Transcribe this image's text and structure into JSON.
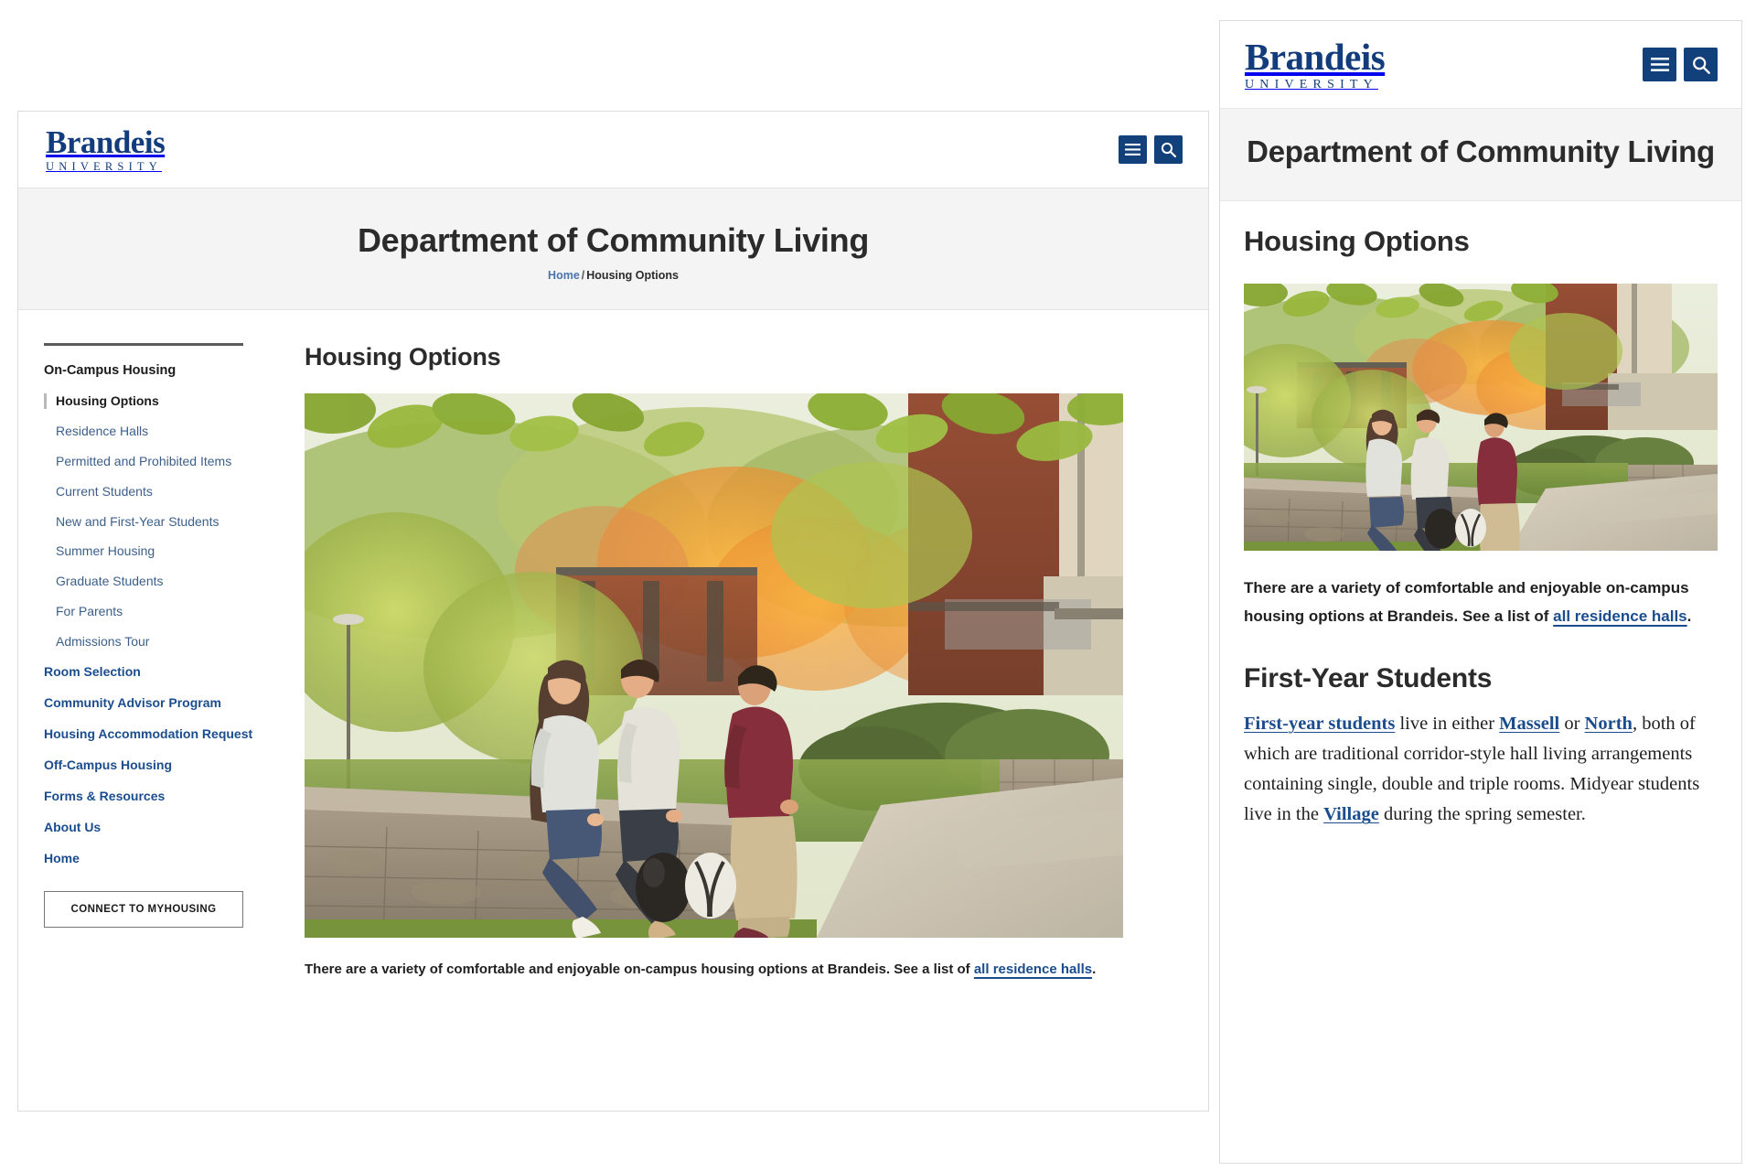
{
  "brand": {
    "logo_word": "Brandeis",
    "logo_sub": "UNIVERSITY",
    "navy": "#12407B",
    "link_blue": "#1b4d8e",
    "sidebar_link": "#3c5f8a",
    "band_gray": "#f4f4f4"
  },
  "header": {
    "menu_icon": "hamburger-menu-icon",
    "search_icon": "search-icon"
  },
  "desktop": {
    "page_title": "Department of Community Living",
    "breadcrumb": {
      "home": "Home",
      "separator": "/",
      "current": "Housing Options"
    },
    "sidebar": {
      "group_label": "On-Campus Housing",
      "sub_items": [
        {
          "label": "Housing Options",
          "active": true
        },
        {
          "label": "Residence Halls",
          "active": false
        },
        {
          "label": "Permitted and Prohibited Items",
          "active": false
        },
        {
          "label": "Current Students",
          "active": false
        },
        {
          "label": "New and First-Year Students",
          "active": false
        },
        {
          "label": "Summer Housing",
          "active": false
        },
        {
          "label": "Graduate Students",
          "active": false
        },
        {
          "label": "For Parents",
          "active": false
        },
        {
          "label": "Admissions Tour",
          "active": false
        }
      ],
      "top_items": [
        {
          "label": "Room Selection"
        },
        {
          "label": "Community Advisor Program"
        },
        {
          "label": "Housing Accommodation Request"
        },
        {
          "label": "Off-Campus Housing"
        },
        {
          "label": "Forms & Resources"
        },
        {
          "label": "About Us"
        },
        {
          "label": "Home"
        }
      ],
      "cta_label": "CONNECT TO MYHOUSING"
    },
    "main": {
      "heading": "Housing Options",
      "photo_alt": "three students talking by a stone wall on campus in autumn",
      "paragraph_pre": "There are a variety of comfortable and enjoyable on-campus housing options at Brandeis. See a list of ",
      "paragraph_link": "all residence halls",
      "paragraph_post": "."
    }
  },
  "mobile": {
    "page_title": "Department of Community Living",
    "heading": "Housing Options",
    "photo_alt": "three students talking by a stone wall on campus in autumn",
    "paragraph_pre": "There are a variety of comfortable and enjoyable on-campus housing options at Brandeis. See a list of ",
    "paragraph_link": "all residence halls",
    "paragraph_post": ".",
    "section_heading": "First-Year Students",
    "section_parts": {
      "link1": "First-year students",
      "t1": " live in either ",
      "link2": "Massell",
      "t2": " or ",
      "link3": "North",
      "t3": ", both of which are traditional corridor-style hall living arrangements containing single, double and triple rooms. Midyear students live in the ",
      "link4": "Village",
      "t4": " during the spring semester."
    }
  }
}
